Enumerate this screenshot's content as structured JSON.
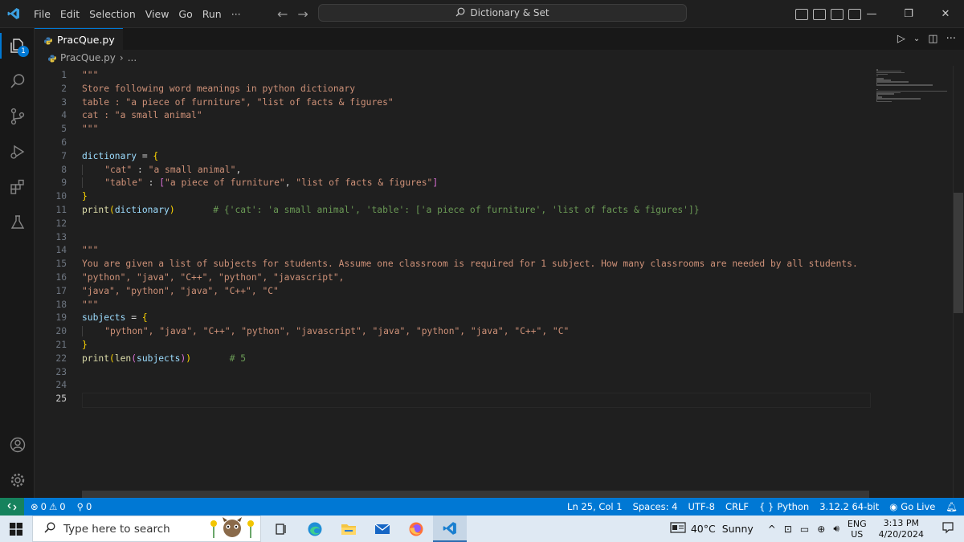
{
  "titlebar": {
    "menus": [
      "File",
      "Edit",
      "Selection",
      "View",
      "Go",
      "Run",
      "···"
    ],
    "command_center": "Dictionary & Set"
  },
  "activity": {
    "badge": "1"
  },
  "tab": {
    "filename": "PracQue.py"
  },
  "breadcrumb": {
    "file": "PracQue.py",
    "rest": "..."
  },
  "editor": {
    "current_line": 25,
    "line_numbers": [
      "1",
      "2",
      "3",
      "4",
      "5",
      "6",
      "7",
      "8",
      "9",
      "10",
      "11",
      "12",
      "13",
      "14",
      "15",
      "16",
      "17",
      "18",
      "19",
      "20",
      "21",
      "22",
      "23",
      "24",
      "25"
    ],
    "lines": {
      "l1": "\"\"\"",
      "l2": "Store following word meanings in python dictionary",
      "l3": "table : \"a piece of furniture\", \"list of facts & figures\"",
      "l4": "cat : \"a small animal\"",
      "l5": "\"\"\"",
      "l7_var": "dictionary",
      "l7_op": " = ",
      "l7_br": "{",
      "l8_key": "\"cat\"",
      "l8_sep": " : ",
      "l8_val": "\"a small animal\"",
      "l8_comma": ",",
      "l9_key": "\"table\"",
      "l9_sep": " : ",
      "l9_br_open": "[",
      "l9_v1": "\"a piece of furniture\"",
      "l9_comma": ", ",
      "l9_v2": "\"list of facts & figures\"",
      "l9_br_close": "]",
      "l10_br": "}",
      "l11_fn": "print",
      "l11_open": "(",
      "l11_arg": "dictionary",
      "l11_close": ")",
      "l11_comment": "# {'cat': 'a small animal', 'table': ['a piece of furniture', 'list of facts & figures']}",
      "l14": "\"\"\"",
      "l15": "You are given a list of subjects for students. Assume one classroom is required for 1 subject. How many classrooms are needed by all students.",
      "l16": "\"python\", \"java\", \"C++\", \"python\", \"javascript\",",
      "l17": "\"java\", \"python\", \"java\", \"C++\", \"C\"",
      "l18": "\"\"\"",
      "l19_var": "subjects",
      "l19_op": " = ",
      "l19_br": "{",
      "l20": "\"python\", \"java\", \"C++\", \"python\", \"javascript\", \"java\", \"python\", \"java\", \"C++\", \"C\"",
      "l21_br": "}",
      "l22_fn1": "print",
      "l22_o1": "(",
      "l22_fn2": "len",
      "l22_o2": "(",
      "l22_arg": "subjects",
      "l22_c2": ")",
      "l22_c1": ")",
      "l22_comment": "# 5"
    }
  },
  "statusbar": {
    "errors": "0",
    "warnings": "0",
    "ports": "0",
    "position": "Ln 25, Col 1",
    "spaces": "Spaces: 4",
    "encoding": "UTF-8",
    "eol": "CRLF",
    "language": "Python",
    "interpreter": "3.12.2 64-bit",
    "golive": "Go Live"
  },
  "taskbar": {
    "search_placeholder": "Type here to search",
    "weather": "40°C  Sunny",
    "lang_top": "ENG",
    "lang_bottom": "US",
    "time": "3:13 PM",
    "date": "4/20/2024"
  },
  "colors": {
    "accent": "#0078d4",
    "remote": "#16825d",
    "string": "#ce9178",
    "variable": "#9cdcfe",
    "function": "#dcdcaa",
    "comment": "#6a9955"
  }
}
